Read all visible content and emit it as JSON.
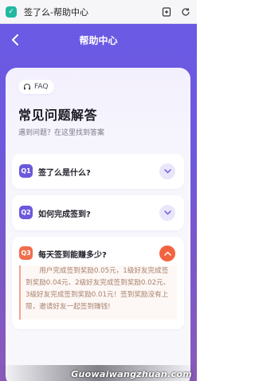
{
  "browser": {
    "title": "签了么-帮助中心",
    "icons": [
      "shield-icon",
      "bookmark-add-icon",
      "refresh-icon"
    ]
  },
  "header": {
    "back_icon": "chevron-left-icon",
    "title": "帮助中心"
  },
  "faq": {
    "tag_label": "FAQ",
    "tag_icon": "headset-icon",
    "heading": "常见问题解答",
    "subheading": "遇到问题？在这里找到答案",
    "items": [
      {
        "badge": "Q1",
        "question": "签了么是什么?",
        "expanded": false
      },
      {
        "badge": "Q2",
        "question": "如何完成签到?",
        "expanded": false
      },
      {
        "badge": "Q3",
        "question": "每天签到能赚多少?",
        "expanded": true,
        "answer": "用户完成签到奖励0.05元，1级好友完成签到奖励0.04元、2级好友完成签到奖励0.02元、3级好友完成签到奖励0.01元！签到奖励没有上限，邀请好友一起签到赚钱!"
      }
    ]
  },
  "watermark": {
    "text": "Guowaiwangzhuan.com"
  },
  "colors": {
    "accent": "#6b59dc",
    "active": "#f2643f",
    "answer_text": "#a9806e"
  }
}
